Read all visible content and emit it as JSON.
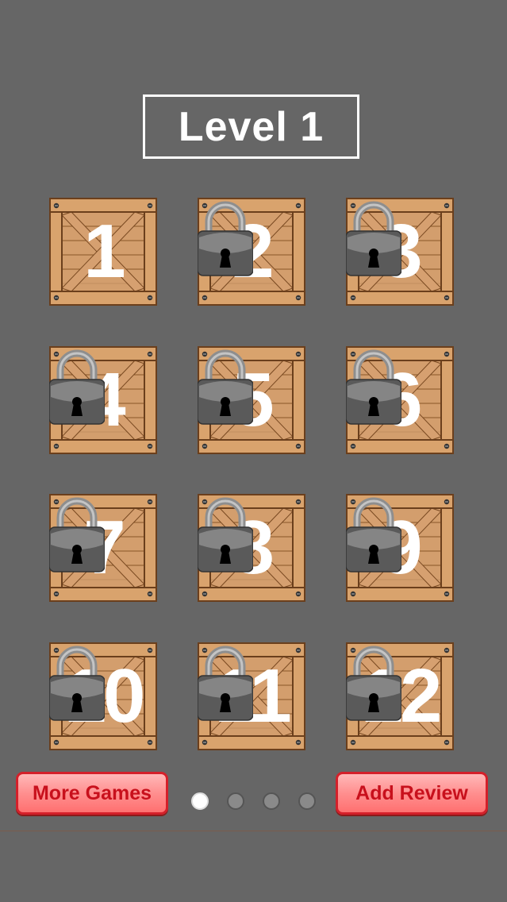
{
  "title": "Level 1",
  "levels": [
    {
      "number": "1",
      "locked": false
    },
    {
      "number": "2",
      "locked": true
    },
    {
      "number": "3",
      "locked": true
    },
    {
      "number": "4",
      "locked": true
    },
    {
      "number": "5",
      "locked": true
    },
    {
      "number": "6",
      "locked": true
    },
    {
      "number": "7",
      "locked": true
    },
    {
      "number": "8",
      "locked": true
    },
    {
      "number": "9",
      "locked": true
    },
    {
      "number": "10",
      "locked": true
    },
    {
      "number": "11",
      "locked": true
    },
    {
      "number": "12",
      "locked": true
    }
  ],
  "buttons": {
    "more_games": "More Games",
    "add_review": "Add Review"
  },
  "pagination": {
    "pages": 4,
    "current": 1
  },
  "colors": {
    "background": "#666666",
    "crate_wood": "#d4a373",
    "button_text": "#c8101c"
  }
}
